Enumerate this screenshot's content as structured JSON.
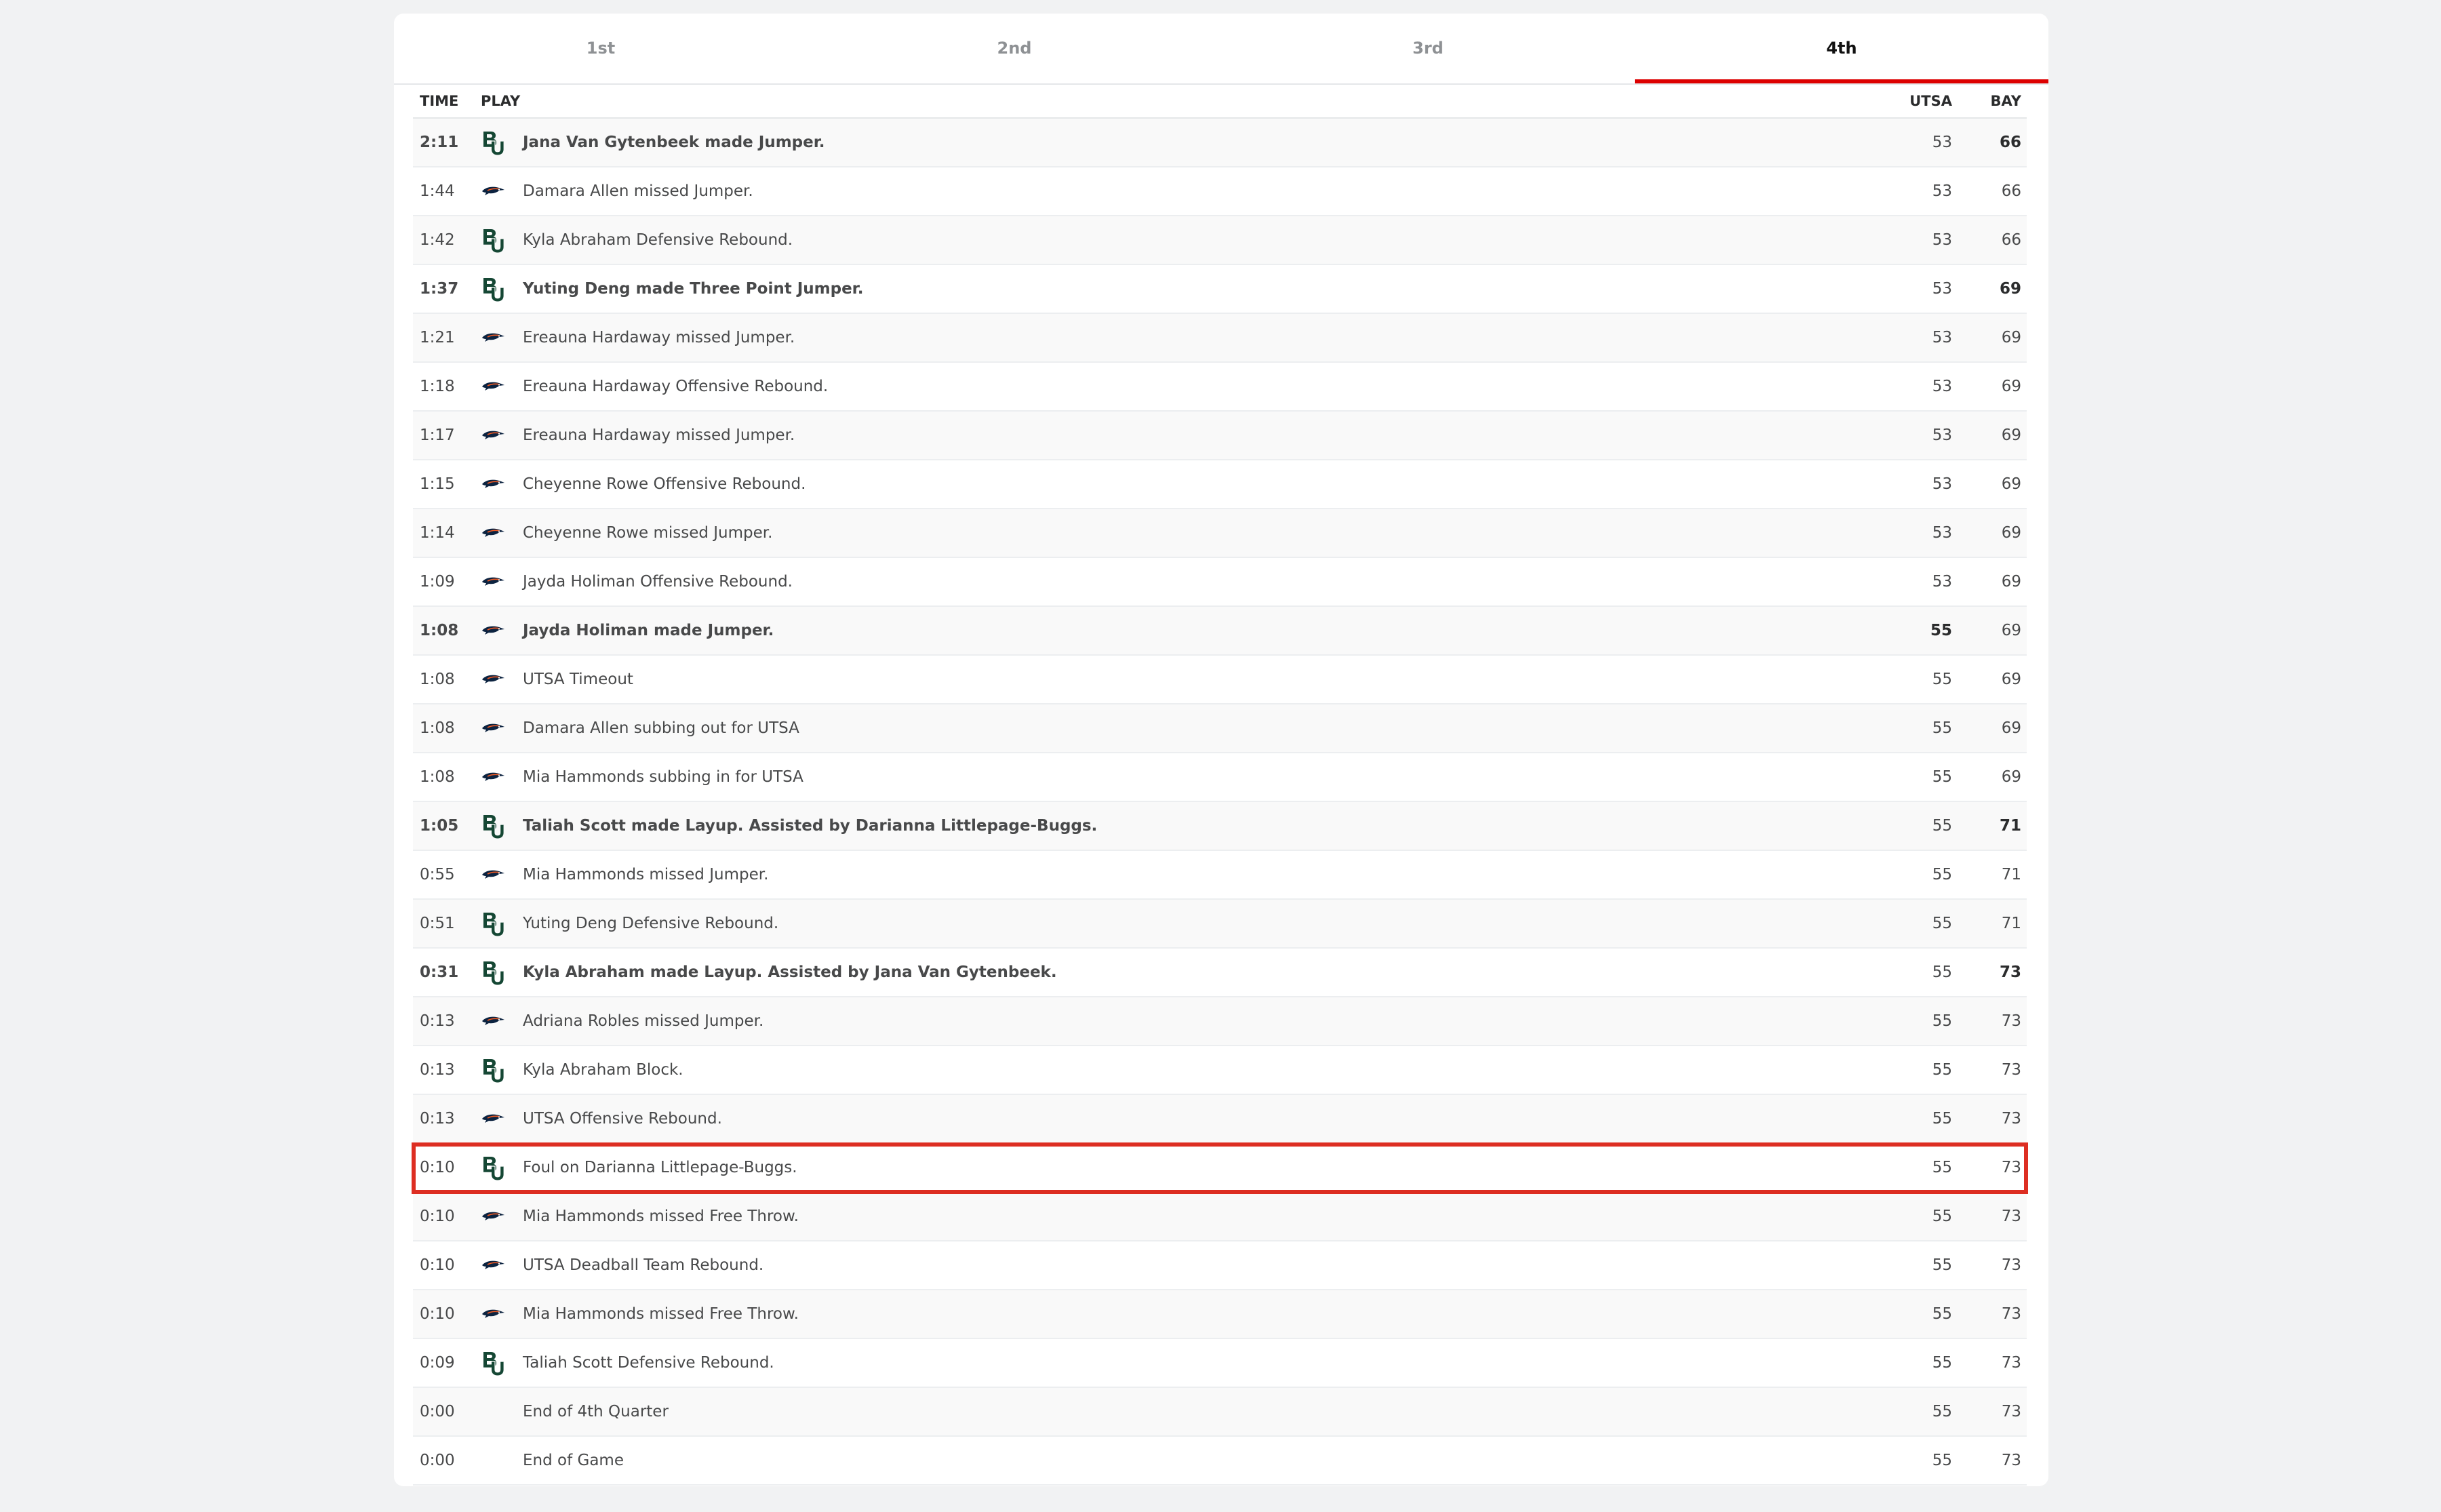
{
  "tabs": [
    "1st",
    "2nd",
    "3rd",
    "4th"
  ],
  "active_tab": 3,
  "columns": {
    "time": "TIME",
    "play": "PLAY",
    "utsa": "UTSA",
    "bay": "BAY"
  },
  "team_logo_icons": {
    "BAY": "baylor-bu-logo-icon",
    "UTSA": "utsa-roadrunner-logo-icon"
  },
  "colors": {
    "accent": "#d00000",
    "highlight": "#dd2e22",
    "baylor_green": "#154734",
    "utsa_navy": "#0c2340"
  },
  "plays": [
    {
      "time": "2:11",
      "team": "BAY",
      "desc": "Jana Van Gytenbeek made Jumper.",
      "utsa": "53",
      "bay": "66",
      "scoring": true,
      "scorer": "BAY"
    },
    {
      "time": "1:44",
      "team": "UTSA",
      "desc": "Damara Allen missed Jumper.",
      "utsa": "53",
      "bay": "66"
    },
    {
      "time": "1:42",
      "team": "BAY",
      "desc": "Kyla Abraham Defensive Rebound.",
      "utsa": "53",
      "bay": "66"
    },
    {
      "time": "1:37",
      "team": "BAY",
      "desc": "Yuting Deng made Three Point Jumper.",
      "utsa": "53",
      "bay": "69",
      "scoring": true,
      "scorer": "BAY"
    },
    {
      "time": "1:21",
      "team": "UTSA",
      "desc": "Ereauna Hardaway missed Jumper.",
      "utsa": "53",
      "bay": "69"
    },
    {
      "time": "1:18",
      "team": "UTSA",
      "desc": "Ereauna Hardaway Offensive Rebound.",
      "utsa": "53",
      "bay": "69"
    },
    {
      "time": "1:17",
      "team": "UTSA",
      "desc": "Ereauna Hardaway missed Jumper.",
      "utsa": "53",
      "bay": "69"
    },
    {
      "time": "1:15",
      "team": "UTSA",
      "desc": "Cheyenne Rowe Offensive Rebound.",
      "utsa": "53",
      "bay": "69"
    },
    {
      "time": "1:14",
      "team": "UTSA",
      "desc": "Cheyenne Rowe missed Jumper.",
      "utsa": "53",
      "bay": "69"
    },
    {
      "time": "1:09",
      "team": "UTSA",
      "desc": "Jayda Holiman Offensive Rebound.",
      "utsa": "53",
      "bay": "69"
    },
    {
      "time": "1:08",
      "team": "UTSA",
      "desc": "Jayda Holiman made Jumper.",
      "utsa": "55",
      "bay": "69",
      "scoring": true,
      "scorer": "UTSA"
    },
    {
      "time": "1:08",
      "team": "UTSA",
      "desc": "UTSA Timeout",
      "utsa": "55",
      "bay": "69"
    },
    {
      "time": "1:08",
      "team": "UTSA",
      "desc": "Damara Allen subbing out for UTSA",
      "utsa": "55",
      "bay": "69"
    },
    {
      "time": "1:08",
      "team": "UTSA",
      "desc": "Mia Hammonds subbing in for UTSA",
      "utsa": "55",
      "bay": "69"
    },
    {
      "time": "1:05",
      "team": "BAY",
      "desc": "Taliah Scott made Layup. Assisted by Darianna Littlepage-Buggs.",
      "utsa": "55",
      "bay": "71",
      "scoring": true,
      "scorer": "BAY"
    },
    {
      "time": "0:55",
      "team": "UTSA",
      "desc": "Mia Hammonds missed Jumper.",
      "utsa": "55",
      "bay": "71"
    },
    {
      "time": "0:51",
      "team": "BAY",
      "desc": "Yuting Deng Defensive Rebound.",
      "utsa": "55",
      "bay": "71"
    },
    {
      "time": "0:31",
      "team": "BAY",
      "desc": "Kyla Abraham made Layup. Assisted by Jana Van Gytenbeek.",
      "utsa": "55",
      "bay": "73",
      "scoring": true,
      "scorer": "BAY"
    },
    {
      "time": "0:13",
      "team": "UTSA",
      "desc": "Adriana Robles missed Jumper.",
      "utsa": "55",
      "bay": "73"
    },
    {
      "time": "0:13",
      "team": "BAY",
      "desc": "Kyla Abraham Block.",
      "utsa": "55",
      "bay": "73"
    },
    {
      "time": "0:13",
      "team": "UTSA",
      "desc": "UTSA Offensive Rebound.",
      "utsa": "55",
      "bay": "73"
    },
    {
      "time": "0:10",
      "team": "BAY",
      "desc": "Foul on Darianna Littlepage-Buggs.",
      "utsa": "55",
      "bay": "73",
      "highlighted": true
    },
    {
      "time": "0:10",
      "team": "UTSA",
      "desc": "Mia Hammonds missed Free Throw.",
      "utsa": "55",
      "bay": "73"
    },
    {
      "time": "0:10",
      "team": "UTSA",
      "desc": "UTSA Deadball Team Rebound.",
      "utsa": "55",
      "bay": "73"
    },
    {
      "time": "0:10",
      "team": "UTSA",
      "desc": "Mia Hammonds missed Free Throw.",
      "utsa": "55",
      "bay": "73"
    },
    {
      "time": "0:09",
      "team": "BAY",
      "desc": "Taliah Scott Defensive Rebound.",
      "utsa": "55",
      "bay": "73"
    },
    {
      "time": "0:00",
      "team": "",
      "desc": "End of 4th Quarter",
      "utsa": "55",
      "bay": "73"
    },
    {
      "time": "0:00",
      "team": "",
      "desc": "End of Game",
      "utsa": "55",
      "bay": "73"
    }
  ]
}
